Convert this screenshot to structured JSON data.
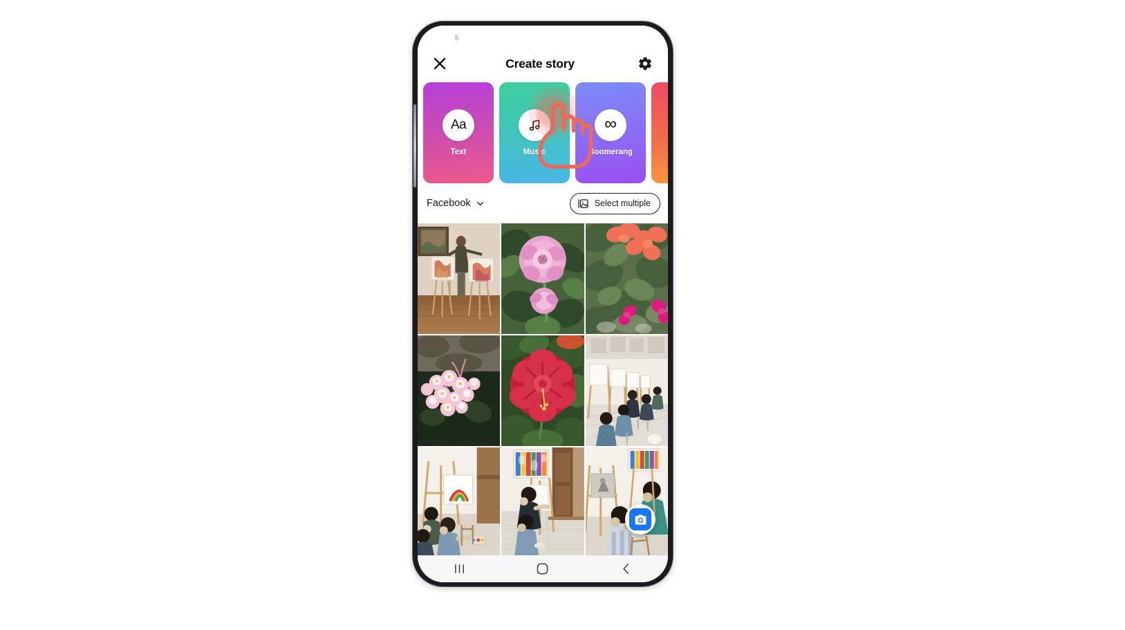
{
  "status_bar": {
    "clock": "5"
  },
  "header": {
    "title": "Create story",
    "close_icon": "close-icon",
    "settings_icon": "gear-icon"
  },
  "story_types": [
    {
      "label": "Text",
      "icon": "text-aa-icon",
      "glyph": "Aa",
      "gradient_from": "#b63fd9",
      "gradient_to": "#ec5a88"
    },
    {
      "label": "Music",
      "icon": "music-note-icon",
      "glyph": "",
      "gradient_from": "#3ecf9f",
      "gradient_to": "#49b6e9"
    },
    {
      "label": "Boomerang",
      "icon": "infinity-icon",
      "glyph": "∞",
      "gradient_from": "#7b8cf6",
      "gradient_to": "#9b4ef1"
    },
    {
      "label": "",
      "icon": "",
      "glyph": "",
      "gradient_from": "#ef4b62",
      "gradient_to": "#f7a23a"
    }
  ],
  "audience": {
    "label": "Facebook",
    "chevron_icon": "chevron-down-icon"
  },
  "select_multiple": {
    "label": "Select multiple",
    "icon": "multiple-photos-icon"
  },
  "photo_grid": [
    {
      "name": "photo-man-with-paintings"
    },
    {
      "name": "photo-pink-rose"
    },
    {
      "name": "photo-orange-bougainvillea"
    },
    {
      "name": "photo-pink-begonia"
    },
    {
      "name": "photo-red-hibiscus"
    },
    {
      "name": "photo-art-class-hallway"
    },
    {
      "name": "photo-students-painting-rainbow"
    },
    {
      "name": "photo-student-colorful-canvas"
    },
    {
      "name": "photo-child-at-easel"
    }
  ],
  "camera_fab": {
    "icon": "camera-icon",
    "color": "#1877f2"
  },
  "nav_bar": {
    "recents_icon": "recents-icon",
    "home_icon": "home-icon",
    "back_icon": "back-chevron-icon"
  },
  "tap_indicator": {
    "icon": "pointing-hand-icon",
    "color": "#ed6a5a"
  }
}
